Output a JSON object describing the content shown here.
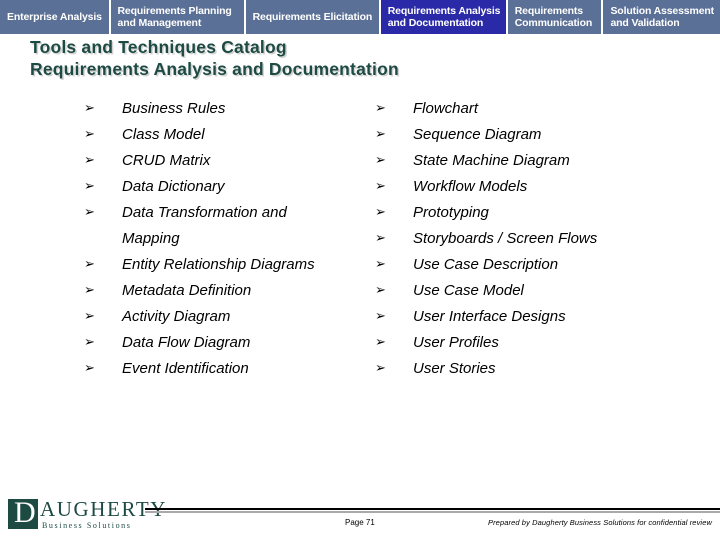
{
  "tabs": [
    {
      "id": "enterprise-analysis",
      "lines": [
        "Enterprise Analysis"
      ],
      "active": false
    },
    {
      "id": "requirements-planning-and-management",
      "lines": [
        "Requirements Planning",
        "and Management"
      ],
      "active": false
    },
    {
      "id": "requirements-elicitation",
      "lines": [
        "Requirements Elicitation"
      ],
      "active": false
    },
    {
      "id": "requirements-analysis-and-documentation",
      "lines": [
        "Requirements Analysis",
        "and Documentation"
      ],
      "active": true
    },
    {
      "id": "requirements-communication",
      "lines": [
        "Requirements",
        "Communication"
      ],
      "active": false
    },
    {
      "id": "solution-assessment-and-validation",
      "lines": [
        "Solution Assessment",
        "and Validation"
      ],
      "active": false
    }
  ],
  "title": {
    "line1": "Tools and Techniques Catalog",
    "line2": "Requirements Analysis and Documentation"
  },
  "bullet_marker": "➢",
  "lists": {
    "left": [
      "Business Rules",
      "Class Model",
      "CRUD Matrix",
      "Data Dictionary",
      "Data Transformation and\nMapping",
      "Entity Relationship Diagrams",
      "Metadata Definition",
      "Activity Diagram",
      "Data Flow Diagram",
      "Event Identification"
    ],
    "right": [
      "Flowchart",
      "Sequence Diagram",
      "State Machine Diagram",
      "Workflow Models",
      "Prototyping",
      "Storyboards / Screen Flows",
      "Use Case Description",
      "Use Case Model",
      "User Interface Designs",
      "User Profiles",
      "User Stories"
    ]
  },
  "footer": {
    "logo_letter": "D",
    "logo_name": "AUGHERTY",
    "logo_tagline": "Business Solutions",
    "page_number": "Page 71",
    "confidential_note": "Prepared by Daugherty Business Solutions for confidential review"
  },
  "colors": {
    "tab_inactive": "#5b7096",
    "tab_active": "#2a2aa8",
    "title_text": "#1e4a44",
    "title_shadow": "#d3d3d3",
    "logo_teal": "#1e4a44",
    "rule_thick": "#000000",
    "rule_thin": "#a9a9a9"
  }
}
